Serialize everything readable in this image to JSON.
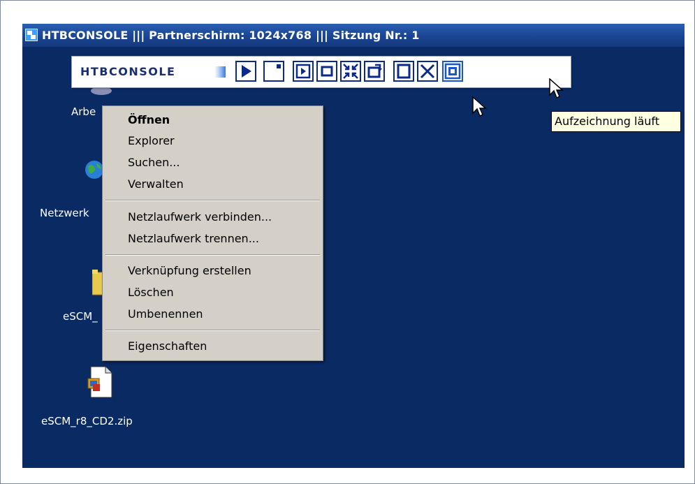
{
  "window": {
    "title": "HTBCONSOLE  |||  Partnerschirm: 1024x768  |||  Sitzung Nr.: 1"
  },
  "toolbar": {
    "logo_text": "HTBCONSOLE",
    "buttons": [
      {
        "icon": "play-icon"
      },
      {
        "icon": "record-indicator-icon"
      },
      {
        "icon": "play-in-frame-icon"
      },
      {
        "icon": "window-icon"
      },
      {
        "icon": "compress-arrows-icon"
      },
      {
        "icon": "rotate-window-icon"
      },
      {
        "icon": "square-icon"
      },
      {
        "icon": "close-x-icon"
      },
      {
        "icon": "recording-icon"
      }
    ]
  },
  "desktop": {
    "icons": [
      {
        "label": "Arbe",
        "icon": "my-computer-icon"
      },
      {
        "label": "Netzwerk",
        "icon": "network-globe-icon"
      },
      {
        "label": "eSCM_",
        "icon": "folder-icon"
      },
      {
        "label": "eSCM_r8_CD2.zip",
        "icon": "zip-file-icon"
      }
    ]
  },
  "context_menu": {
    "items": [
      {
        "label": "Öffnen",
        "bold": true
      },
      {
        "label": "Explorer"
      },
      {
        "label": "Suchen..."
      },
      {
        "label": "Verwalten"
      },
      {
        "label": "Netzlaufwerk verbinden..."
      },
      {
        "label": "Netzlaufwerk trennen..."
      },
      {
        "label": "Verknüpfung erstellen"
      },
      {
        "label": "Löschen"
      },
      {
        "label": "Umbenennen"
      },
      {
        "label": "Eigenschaften"
      }
    ]
  },
  "tooltip": {
    "text": "Aufzeichnung läuft"
  },
  "colors": {
    "desktop": "#0a2a63",
    "titlebar": "#1a4593",
    "menu": "#d4d0c8",
    "tooltip": "#ffffe1",
    "toolbar_icon": "#0b2a8a"
  }
}
